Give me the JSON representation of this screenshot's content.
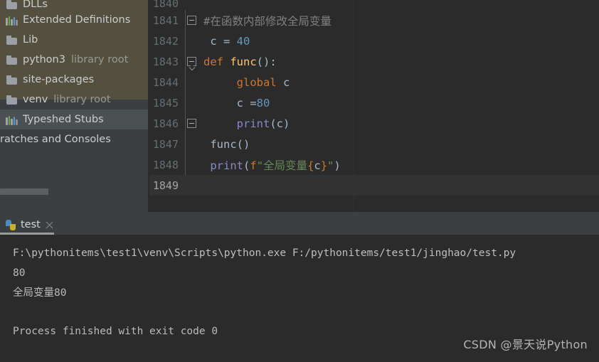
{
  "sidebar": {
    "items": [
      {
        "label": "DLLs",
        "sub": "",
        "icon": "folder-icon",
        "partial": true,
        "selected": false
      },
      {
        "label": "Extended Definitions",
        "sub": "",
        "icon": "library-icon",
        "partial": false,
        "selected": false
      },
      {
        "label": "Lib",
        "sub": "",
        "icon": "folder-icon",
        "partial": false,
        "selected": false
      },
      {
        "label": "python3",
        "sub": "library root",
        "icon": "folder-icon",
        "partial": false,
        "selected": false
      },
      {
        "label": "site-packages",
        "sub": "",
        "icon": "folder-icon",
        "partial": false,
        "selected": false
      },
      {
        "label": "venv",
        "sub": "library root",
        "icon": "folder-icon",
        "partial": false,
        "selected": false
      },
      {
        "label": "Typeshed Stubs",
        "sub": "",
        "icon": "library-icon",
        "partial": false,
        "selected": true
      },
      {
        "label": "ratches and Consoles",
        "sub": "",
        "icon": "none",
        "partial": false,
        "selected": false
      }
    ]
  },
  "editor": {
    "lines": [
      {
        "num": "1840",
        "partial": true,
        "current": false,
        "fold": "none",
        "indent_guide": false,
        "tokens": []
      },
      {
        "num": "1841",
        "partial": false,
        "current": false,
        "fold": "box",
        "indent_guide": true,
        "tokens": [
          {
            "t": "comment",
            "v": "#在函数内部修改全局变量"
          }
        ]
      },
      {
        "num": "1842",
        "partial": false,
        "current": false,
        "fold": "none",
        "indent_guide": true,
        "tokens": [
          {
            "t": "plain",
            "v": " c = "
          },
          {
            "t": "num",
            "v": "40"
          }
        ]
      },
      {
        "num": "1843",
        "partial": false,
        "current": false,
        "fold": "box-pointy",
        "indent_guide": true,
        "tokens": [
          {
            "t": "kw",
            "v": "def "
          },
          {
            "t": "fn",
            "v": "func"
          },
          {
            "t": "plain",
            "v": "():"
          }
        ]
      },
      {
        "num": "1844",
        "partial": false,
        "current": false,
        "fold": "none",
        "indent_guide": true,
        "tokens": [
          {
            "t": "plain",
            "v": "     "
          },
          {
            "t": "kw",
            "v": "global"
          },
          {
            "t": "plain",
            "v": " c"
          }
        ]
      },
      {
        "num": "1845",
        "partial": false,
        "current": false,
        "fold": "none",
        "indent_guide": true,
        "tokens": [
          {
            "t": "plain",
            "v": "     c ="
          },
          {
            "t": "num",
            "v": "80"
          }
        ]
      },
      {
        "num": "1846",
        "partial": false,
        "current": false,
        "fold": "box",
        "indent_guide": true,
        "tokens": [
          {
            "t": "plain",
            "v": "     "
          },
          {
            "t": "builtin",
            "v": "print"
          },
          {
            "t": "plain",
            "v": "(c)"
          }
        ]
      },
      {
        "num": "1847",
        "partial": false,
        "current": false,
        "fold": "none",
        "indent_guide": true,
        "tokens": [
          {
            "t": "plain",
            "v": " "
          },
          {
            "t": "fn2",
            "v": "func"
          },
          {
            "t": "plain",
            "v": "()"
          }
        ]
      },
      {
        "num": "1848",
        "partial": false,
        "current": false,
        "fold": "none",
        "indent_guide": true,
        "tokens": [
          {
            "t": "plain",
            "v": " "
          },
          {
            "t": "builtin",
            "v": "print"
          },
          {
            "t": "plain",
            "v": "("
          },
          {
            "t": "fprefix",
            "v": "f"
          },
          {
            "t": "str",
            "v": "\"全局变量"
          },
          {
            "t": "brace",
            "v": "{"
          },
          {
            "t": "ident",
            "v": "c"
          },
          {
            "t": "brace",
            "v": "}"
          },
          {
            "t": "str",
            "v": "\""
          },
          {
            "t": "plain",
            "v": ")"
          }
        ]
      },
      {
        "num": "1849",
        "partial": false,
        "current": true,
        "fold": "none",
        "indent_guide": false,
        "tokens": []
      }
    ]
  },
  "run_window": {
    "tab": {
      "label": "test",
      "icon": "python-file-icon",
      "close_icon": "close-icon"
    },
    "console_lines": [
      {
        "text": "F:\\pythonitems\\test1\\venv\\Scripts\\python.exe F:/pythonitems/test1/jinghao/test.py",
        "kind": "cmd"
      },
      {
        "text": "80",
        "kind": "out"
      },
      {
        "text": "全局变量80",
        "kind": "out"
      },
      {
        "text": "",
        "kind": "blank"
      },
      {
        "text": "Process finished with exit code 0",
        "kind": "out"
      }
    ]
  },
  "watermark": {
    "text": "CSDN @景天说Python"
  },
  "colors": {
    "editor_bg": "#2b2b2b",
    "sidebar_bg": "#3c3f41",
    "overlay_bg": "#56513f",
    "current_line_bg": "#323232",
    "keyword": "#cc7832",
    "number": "#6897bb",
    "function": "#ffc66d",
    "string": "#6a8759",
    "comment": "#808080",
    "default_text": "#a9b7c6"
  }
}
